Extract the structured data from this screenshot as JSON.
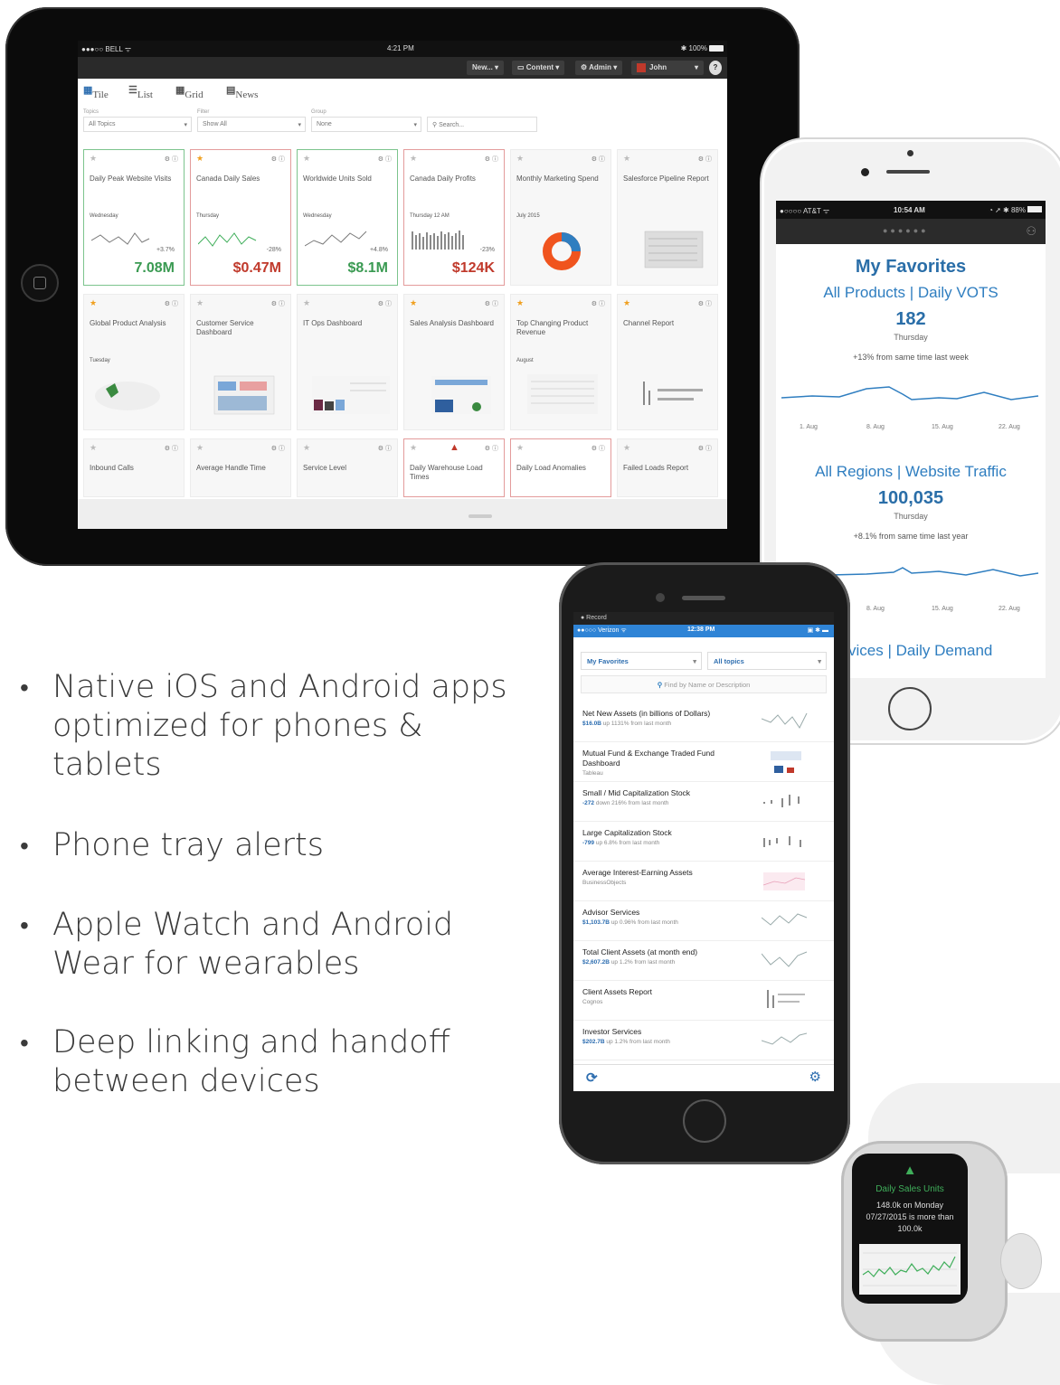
{
  "tablet": {
    "status": {
      "carrier": "●●●○○ BELL ᯤ",
      "time": "4:21 PM",
      "battery": "✱ 100%"
    },
    "nav": {
      "new": "New... ▾",
      "content": "Content ▾",
      "admin": "Admin ▾",
      "user": "John",
      "help": "?"
    },
    "view_tabs": [
      "Tile",
      "List",
      "Grid",
      "News"
    ],
    "filters": {
      "topics_label": "Topics",
      "topics_value": "All Topics",
      "filter_label": "Filter",
      "filter_value": "Show All",
      "group_label": "Group",
      "group_value": "None",
      "search_placeholder": "Search..."
    },
    "tiles": [
      {
        "title": "Daily Peak Website Visits",
        "day": "Wednesday",
        "pct": "+3.7%",
        "value": "7.08M",
        "star": false,
        "border": "green",
        "value_color": "#3a9a52"
      },
      {
        "title": "Canada Daily Sales",
        "day": "Thursday",
        "pct": "-28%",
        "value": "$0.47M",
        "star": true,
        "border": "red",
        "value_color": "#c0392b"
      },
      {
        "title": "Worldwide Units Sold",
        "day": "Wednesday",
        "pct": "+4.8%",
        "value": "$8.1M",
        "star": false,
        "border": "green",
        "value_color": "#3a9a52"
      },
      {
        "title": "Canada Daily Profits",
        "day": "Thursday 12 AM",
        "pct": "-23%",
        "value": "$124K",
        "star": false,
        "border": "red",
        "value_color": "#c0392b"
      },
      {
        "title": "Monthly Marketing Spend",
        "day": "July 2015",
        "pct": "",
        "value": "",
        "star": false,
        "border": "none",
        "value_color": "#333"
      },
      {
        "title": "Salesforce Pipeline Report",
        "day": "",
        "pct": "",
        "value": "",
        "star": false,
        "border": "none",
        "value_color": "#333"
      },
      {
        "title": "Global Product Analysis",
        "day": "Tuesday",
        "pct": "",
        "value": "",
        "star": true,
        "border": "none",
        "value_color": "#333"
      },
      {
        "title": "Customer Service Dashboard",
        "day": "",
        "pct": "",
        "value": "",
        "star": false,
        "border": "none",
        "value_color": "#333"
      },
      {
        "title": "IT Ops Dashboard",
        "day": "",
        "pct": "",
        "value": "",
        "star": false,
        "border": "none",
        "value_color": "#333"
      },
      {
        "title": "Sales Analysis Dashboard",
        "day": "",
        "pct": "",
        "value": "",
        "star": true,
        "border": "none",
        "value_color": "#333"
      },
      {
        "title": "Top Changing Product Revenue",
        "day": "August",
        "pct": "",
        "value": "",
        "star": true,
        "border": "none",
        "value_color": "#333"
      },
      {
        "title": "Channel Report",
        "day": "",
        "pct": "",
        "value": "",
        "star": true,
        "border": "none",
        "value_color": "#333"
      },
      {
        "title": "Inbound Calls",
        "day": "",
        "pct": "",
        "value": "",
        "star": false,
        "border": "none",
        "value_color": "#333"
      },
      {
        "title": "Average Handle Time",
        "day": "",
        "pct": "",
        "value": "",
        "star": false,
        "border": "none",
        "value_color": "#333"
      },
      {
        "title": "Service Level",
        "day": "",
        "pct": "",
        "value": "",
        "star": false,
        "border": "none",
        "value_color": "#333"
      },
      {
        "title": "Daily Warehouse Load Times",
        "day": "",
        "pct": "",
        "value": "",
        "star": false,
        "border": "red",
        "value_color": "#333"
      },
      {
        "title": "Daily Load Anomalies",
        "day": "",
        "pct": "",
        "value": "",
        "star": false,
        "border": "red",
        "value_color": "#333"
      },
      {
        "title": "Failed Loads Report",
        "day": "",
        "pct": "",
        "value": "",
        "star": false,
        "border": "none",
        "value_color": "#333"
      }
    ]
  },
  "white_phone": {
    "status": {
      "carrier": "●○○○○ AT&T ᯤ",
      "time": "10:54 AM",
      "battery": "◔ ➚ ✱ 88%"
    },
    "title": "My Favorites",
    "kpi1": {
      "name": "All Products | Daily VOTS",
      "value": "182",
      "day": "Thursday",
      "delta": "+13%",
      "delta_text": "from same time last week",
      "ticks": [
        "1. Aug",
        "8. Aug",
        "15. Aug",
        "22. Aug"
      ]
    },
    "kpi2": {
      "name": "All Regions | Website Traffic",
      "value": "100,035",
      "day": "Thursday",
      "delta": "+8.1%",
      "delta_text": "from same time last year",
      "ticks": [
        "8. Aug",
        "15. Aug",
        "22. Aug"
      ]
    },
    "kpi3": {
      "name": "vices | Daily Demand"
    }
  },
  "black_phone": {
    "record": "● Record",
    "status": {
      "carrier": "●●○○○ Verizon ᯤ",
      "time": "12:38 PM",
      "battery": "▣ ✱ ▬"
    },
    "favorites_select": "My Favorites",
    "topics_select": "All topics",
    "search_placeholder": "Find by Name or Description",
    "rows": [
      {
        "title": "Net New Assets (in billions of Dollars)",
        "sub_bold": "$16.0B",
        "sub": "up 1131% from last month"
      },
      {
        "title": "Mutual Fund & Exchange Traded Fund Dashboard",
        "sub_bold": "",
        "sub": "Tableau"
      },
      {
        "title": "Small / Mid Capitalization Stock",
        "sub_bold": "-272",
        "sub": "down 216% from last month"
      },
      {
        "title": "Large Capitalization Stock",
        "sub_bold": "-799",
        "sub": "up 6.8% from last month"
      },
      {
        "title": "Average Interest-Earning Assets",
        "sub_bold": "",
        "sub": "BusinessObjects"
      },
      {
        "title": "Advisor Services",
        "sub_bold": "$1,103.7B",
        "sub": "up 0.96% from last month"
      },
      {
        "title": "Total Client Assets (at month end)",
        "sub_bold": "$2,607.2B",
        "sub": "up 1.2% from last month"
      },
      {
        "title": "Client Assets Report",
        "sub_bold": "",
        "sub": "Cognos"
      },
      {
        "title": "Investor Services",
        "sub_bold": "$202.7B",
        "sub": "up 1.2% from last month"
      }
    ]
  },
  "watch": {
    "title": "Daily Sales Units",
    "message": "148.0k on Monday 07/27/2015 is more than 100.0k"
  },
  "bullets": [
    "Native iOS and Android apps optimized for phones & tablets",
    "Phone tray alerts",
    "Apple Watch and Android Wear for wearables",
    "Deep linking and handoff between devices"
  ],
  "colors": {
    "accent_blue": "#2f7ec0",
    "green": "#3a9a52",
    "red": "#c0392b",
    "star": "#f0a020"
  }
}
